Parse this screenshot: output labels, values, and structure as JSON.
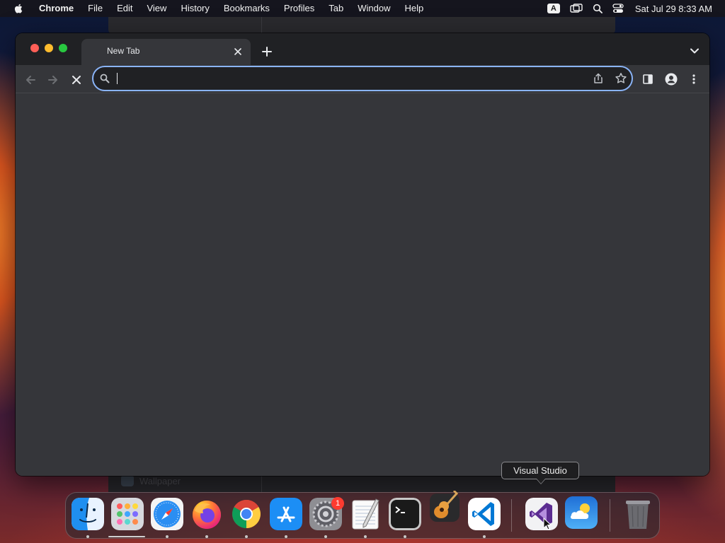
{
  "menubar": {
    "app_name": "Chrome",
    "items": [
      "File",
      "Edit",
      "View",
      "History",
      "Bookmarks",
      "Profiles",
      "Tab",
      "Window",
      "Help"
    ],
    "input_source": "A",
    "clock": "Sat Jul 29  8:33 AM"
  },
  "background_window": {
    "label": "Wallpaper"
  },
  "browser": {
    "tab_title": "New Tab",
    "omnibox_value": "",
    "accent_color": "#8ab4f8"
  },
  "tooltip": {
    "text": "Visual Studio"
  },
  "dock": {
    "apps": [
      {
        "name": "Finder",
        "running": true
      },
      {
        "name": "Launchpad",
        "running": false
      },
      {
        "name": "Safari",
        "running": true
      },
      {
        "name": "Firefox",
        "running": true
      },
      {
        "name": "Google Chrome",
        "running": true
      },
      {
        "name": "App Store",
        "running": true
      },
      {
        "name": "System Settings",
        "running": true,
        "badge": "1"
      },
      {
        "name": "TextEdit",
        "running": true
      },
      {
        "name": "Terminal",
        "running": true
      },
      {
        "name": "GarageBand",
        "running": false
      },
      {
        "name": "Visual Studio Code",
        "running": true
      },
      {
        "name": "Visual Studio",
        "running": false
      },
      {
        "name": "Weather",
        "running": false
      },
      {
        "name": "Trash",
        "running": false
      }
    ],
    "settings_badge": "1"
  }
}
